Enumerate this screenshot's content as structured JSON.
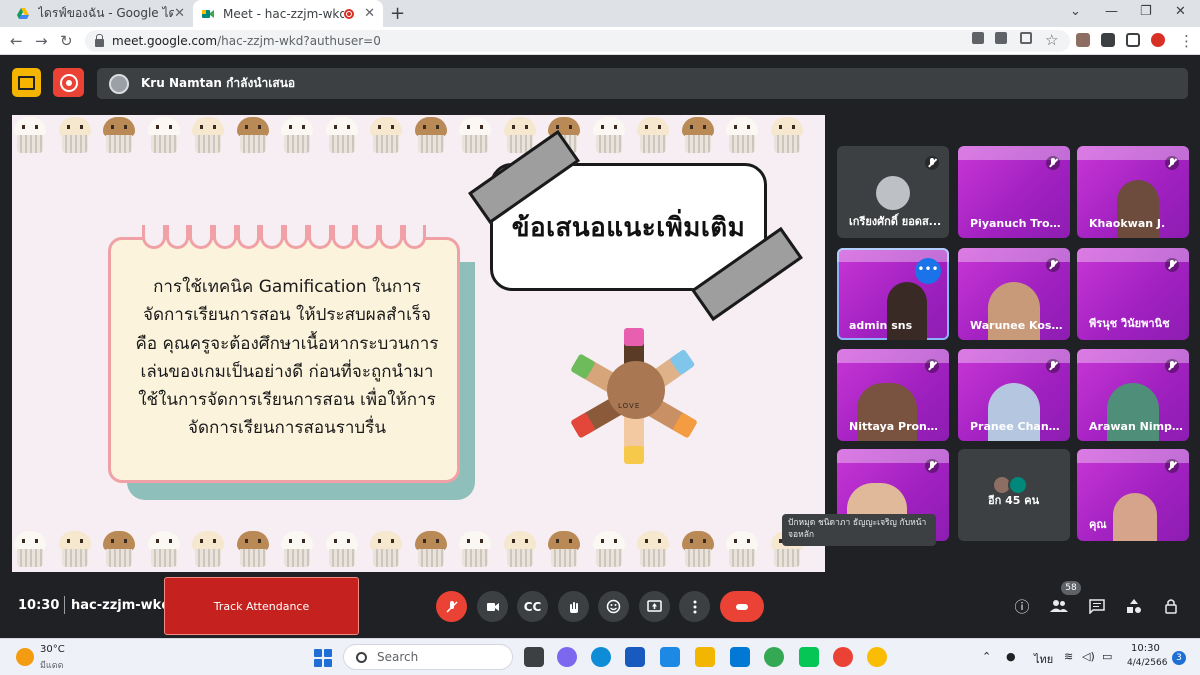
{
  "browser": {
    "tabs": [
      {
        "label": "ไดรฟ์ของฉัน - Google ไดรฟ์",
        "active": false
      },
      {
        "label": "Meet - hac-zzjm-wkd",
        "active": true
      }
    ],
    "url_host": "meet.google.com",
    "url_path": "/hac-zzjm-wkd?authuser=0",
    "new_tab_label": "+"
  },
  "meet": {
    "presenter_text": "Kru Namtan กำลังนำเสนอ",
    "slide": {
      "title": "ข้อเสนอแนะเพิ่มเติม",
      "body": "การใช้เทคนิค Gamification ในการจัดการเรียนการสอน ให้ประสบผลสำเร็จ คือ คุณครูจะต้องศึกษาเนื้อหากระบวนการเล่นของเกมเป็นอย่างดี ก่อนที่จะถูกนำมาใช้ในการจัดการเรียนการสอน เพื่อให้การจัดการเรียนการสอนราบรื่น",
      "hands_label": "LOVE"
    },
    "tooltip": "ปักหมุด ชนิดาภา ธัญญะเจริญ กับหน้าจอหลัก",
    "participants": [
      {
        "name": "เกรียงศักดิ์ ยอดส...",
        "style": "plain"
      },
      {
        "name": "Piyanuch Trouj...",
        "style": "purple"
      },
      {
        "name": "Khaokwan J.",
        "style": "purple"
      },
      {
        "name": "admin sns",
        "style": "purple"
      },
      {
        "name": "Warunee Kosri...",
        "style": "purple"
      },
      {
        "name": "พีรนุช วินัยพานิช",
        "style": "purple"
      },
      {
        "name": "Nittaya Pronpa...",
        "style": "purple"
      },
      {
        "name": "Pranee Chand...",
        "style": "purple"
      },
      {
        "name": "Arawan Nimpu...",
        "style": "purple"
      },
      {
        "name": "",
        "style": "purple"
      },
      {
        "name": "อีก 45 คน",
        "style": "plain"
      },
      {
        "name": "คุณ",
        "style": "purple"
      }
    ],
    "more_dots": "•••",
    "time": "10:30",
    "meeting_code": "hac-zzjm-wkd",
    "track_attendance_label": "Track Attendance",
    "people_count": "58",
    "captions_label": "CC"
  },
  "taskbar": {
    "temperature": "30°C",
    "weather_desc": "มีแดด",
    "search_label": "Search",
    "language": "ไทย",
    "clock_time": "10:30",
    "clock_date": "4/4/2566",
    "notification_count": "3"
  },
  "colors": {
    "meet_bg": "#202124",
    "tile_purple": "#c936d6",
    "end_call": "#ea4335",
    "track_attendance": "#c5221f",
    "slide_bg": "#f6eef2",
    "textbox_fill": "#fbf3dc",
    "textbox_border": "#f0a1a6"
  }
}
